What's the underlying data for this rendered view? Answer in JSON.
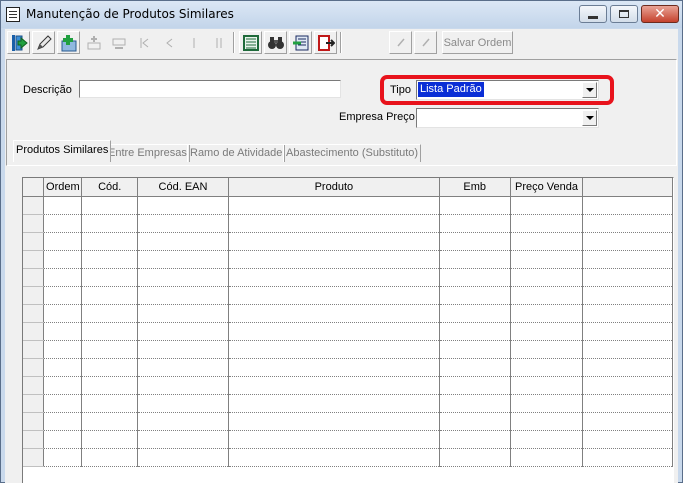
{
  "window": {
    "title": "Manutenção de Produtos Similares",
    "close_glyph": "✕"
  },
  "toolbar": {
    "buttons": [
      {
        "name": "exit-icon",
        "enabled": true
      },
      {
        "name": "edit-icon",
        "enabled": true
      },
      {
        "name": "add-icon",
        "enabled": true
      },
      {
        "name": "insert-row-icon",
        "enabled": false
      },
      {
        "name": "delete-row-icon",
        "enabled": false
      },
      {
        "name": "first-record-icon",
        "enabled": false
      },
      {
        "name": "previous-record-icon",
        "enabled": false
      },
      {
        "name": "next-record-icon",
        "enabled": false
      },
      {
        "name": "last-record-icon",
        "enabled": false
      },
      {
        "name": "list-view-icon",
        "enabled": true
      },
      {
        "name": "binoculars-search-icon",
        "enabled": true
      },
      {
        "name": "import-icon",
        "enabled": true
      },
      {
        "name": "export-icon",
        "enabled": true
      },
      {
        "name": "confirm-icon",
        "enabled": false
      },
      {
        "name": "cancel-icon",
        "enabled": false
      }
    ],
    "save_order_label": "Salvar Ordem"
  },
  "filters": {
    "descricao_label": "Descrição",
    "descricao_value": "",
    "tipo_label": "Tipo",
    "tipo_value": "Lista Padrão",
    "empresa_preco_label": "Empresa Preço",
    "empresa_preco_value": ""
  },
  "tabs": [
    {
      "label": "Produtos Similares",
      "active": true
    },
    {
      "label": "Entre Empresas",
      "active": false
    },
    {
      "label": "Ramo de Atividade",
      "active": false
    },
    {
      "label": "Abastecimento (Substituto)",
      "active": false
    }
  ],
  "grid": {
    "columns": [
      "",
      "Ordem",
      "Cód.",
      "Cód. EAN",
      "Produto",
      "Emb",
      "Preço Venda",
      ""
    ],
    "rows": []
  },
  "colors": {
    "highlight": "#e8131c",
    "selection": "#0a2ed6"
  }
}
